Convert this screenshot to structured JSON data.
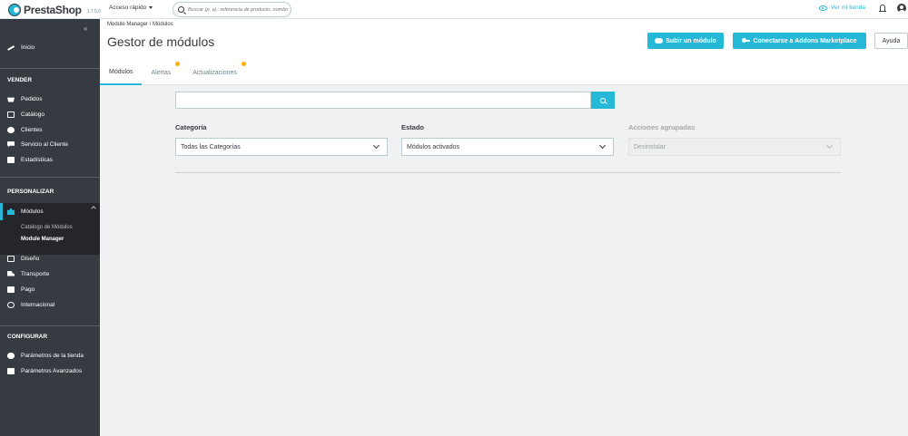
{
  "topbar": {
    "brand": "PrestaShop",
    "version": "1.7.5.0",
    "quick_access": "Acceso rápido",
    "search_placeholder": "Buscar (p. ej.: referencia de producto, nombre de cliente...)",
    "view_store": "Ver mi tienda"
  },
  "sidebar": {
    "collapse": "«",
    "home": "Inicio",
    "sections": {
      "sell": "VENDER",
      "customize": "PERSONALIZAR",
      "configure": "CONFIGURAR"
    },
    "sell_items": [
      "Pedidos",
      "Catálogo",
      "Clientes",
      "Servicio al Cliente",
      "Estadísticas"
    ],
    "modules": "Módulos",
    "modules_sub": [
      "Catálogo de Módulos",
      "Module Manager"
    ],
    "customize_items": [
      "Diseño",
      "Transporte",
      "Pago",
      "Internacional"
    ],
    "configure_items": [
      "Parámetros de la tienda",
      "Parámetros Avanzados"
    ]
  },
  "header": {
    "breadcrumb": "Module Manager  /  Módulos",
    "title": "Gestor de módulos",
    "upload_button": "Subir un módulo",
    "connect_button": "Conectarse a Addons Marketplace",
    "help_button": "Ayuda",
    "tabs": [
      "Módulos",
      "Alertas",
      "Actualizaciones"
    ]
  },
  "filters": {
    "category_label": "Categoría",
    "category_value": "Todas las Categorías",
    "status_label": "Estado",
    "status_value": "Módulos activados",
    "bulk_label": "Acciones agrupadas",
    "bulk_value": "Desinstalar"
  },
  "colors": {
    "accent": "#25b9d7",
    "sidebar": "#363a41",
    "badge": "#fab000"
  }
}
